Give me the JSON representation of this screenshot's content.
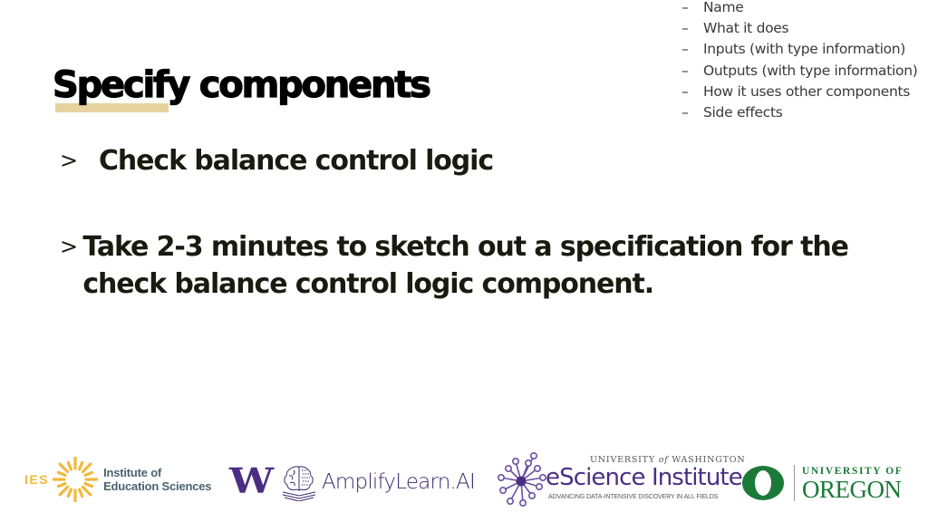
{
  "slide": {
    "title": "Specify components",
    "spec_list": {
      "dash": "–",
      "items": [
        "Name",
        "What it does",
        "Inputs (with type information)",
        "Outputs (with type information)",
        "How it uses other components",
        "Side effects"
      ]
    },
    "bullets": [
      {
        "marker": ">",
        "text": "Check balance control logic"
      },
      {
        "marker": ">",
        "text": "Take 2-3 minutes to sketch out a specification for the check balance control logic component."
      }
    ],
    "colors": {
      "title_highlight": "#e6d29f",
      "text": "#1a1a10",
      "ies_gold": "#f0b83c",
      "ies_gray": "#4a6371",
      "uw_purple": "#4b2e83",
      "oregon_green": "#1b7a3a"
    }
  },
  "footer": {
    "ies": {
      "abbr": "IES",
      "name_line1": "Institute of",
      "name_line2": "Education Sciences",
      "icon": "sun-icon"
    },
    "uw": {
      "letter": "W"
    },
    "amplify": {
      "name": "AmplifyLearn.AI",
      "icon": "brain-book-icon"
    },
    "escience": {
      "uw_prefix": "UNIVERSITY",
      "uw_of": "of",
      "uw_suffix": "WASHINGTON",
      "name": "eScience Institute",
      "tagline": "ADVANCING DATA-INTENSIVE DISCOVERY IN ALL FIELDS",
      "icon": "network-node-icon"
    },
    "oregon": {
      "line1": "UNIVERSITY OF",
      "line2": "OREGON",
      "icon": "o-logo-icon"
    }
  }
}
